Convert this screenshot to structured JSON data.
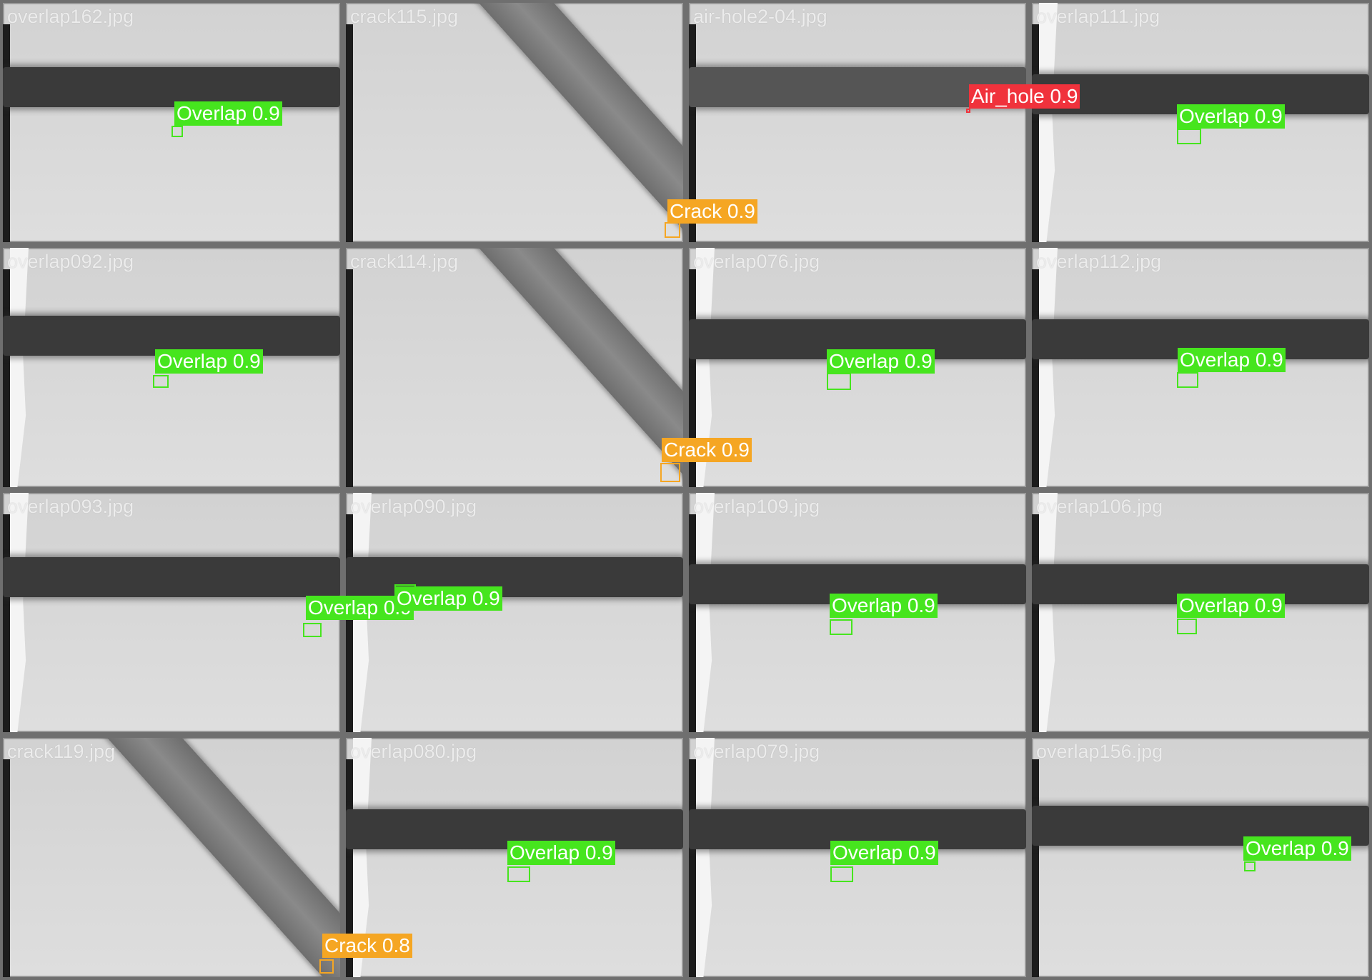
{
  "colors": {
    "Overlap": "#46e51e",
    "Crack": "#f5a623",
    "Air_hole": "#f0323c"
  },
  "tiles": [
    {
      "filename": "overlap162.jpg",
      "scene": "band-plain"
    },
    {
      "filename": "crack115.jpg",
      "scene": "diag"
    },
    {
      "filename": "air-hole2-04.jpg",
      "scene": "band-light"
    },
    {
      "filename": "overlap111.jpg",
      "scene": "band-edge"
    },
    {
      "filename": "overlap092.jpg",
      "scene": "band-edge"
    },
    {
      "filename": "crack114.jpg",
      "scene": "diag"
    },
    {
      "filename": "overlap076.jpg",
      "scene": "band-edge"
    },
    {
      "filename": "overlap112.jpg",
      "scene": "band-edge"
    },
    {
      "filename": "overlap093.jpg",
      "scene": "band-edge"
    },
    {
      "filename": "overlap090.jpg",
      "scene": "band-edge"
    },
    {
      "filename": "overlap109.jpg",
      "scene": "band-edge"
    },
    {
      "filename": "overlap106.jpg",
      "scene": "band-edge"
    },
    {
      "filename": "crack119.jpg",
      "scene": "diag"
    },
    {
      "filename": "overlap080.jpg",
      "scene": "band-edge"
    },
    {
      "filename": "overlap079.jpg",
      "scene": "band-edge"
    },
    {
      "filename": "overlap156.jpg",
      "scene": "band-plain"
    }
  ],
  "detections": [
    {
      "label": "Overlap 0.9",
      "class": "Overlap"
    },
    {
      "label": "Crack 0.9",
      "class": "Crack"
    },
    {
      "label": "Air_hole 0.9",
      "class": "Air_hole"
    },
    {
      "label": "Overlap 0.9",
      "class": "Overlap"
    },
    {
      "label": "Overlap 0.9",
      "class": "Overlap"
    },
    {
      "label": "Crack 0.9",
      "class": "Crack"
    },
    {
      "label": "Overlap 0.9",
      "class": "Overlap"
    },
    {
      "label": "Overlap 0.9",
      "class": "Overlap"
    },
    {
      "label": "Overlap 0.9",
      "class": "Overlap"
    },
    {
      "label": "Overlap 0.9",
      "class": "Overlap"
    },
    {
      "label": "Overlap 0.9",
      "class": "Overlap"
    },
    {
      "label": "Overlap 0.9",
      "class": "Overlap"
    },
    {
      "label": "Crack 0.8",
      "class": "Crack"
    },
    {
      "label": "Overlap 0.9",
      "class": "Overlap"
    },
    {
      "label": "Overlap 0.9",
      "class": "Overlap"
    },
    {
      "label": "Overlap 0.9",
      "class": "Overlap"
    }
  ]
}
